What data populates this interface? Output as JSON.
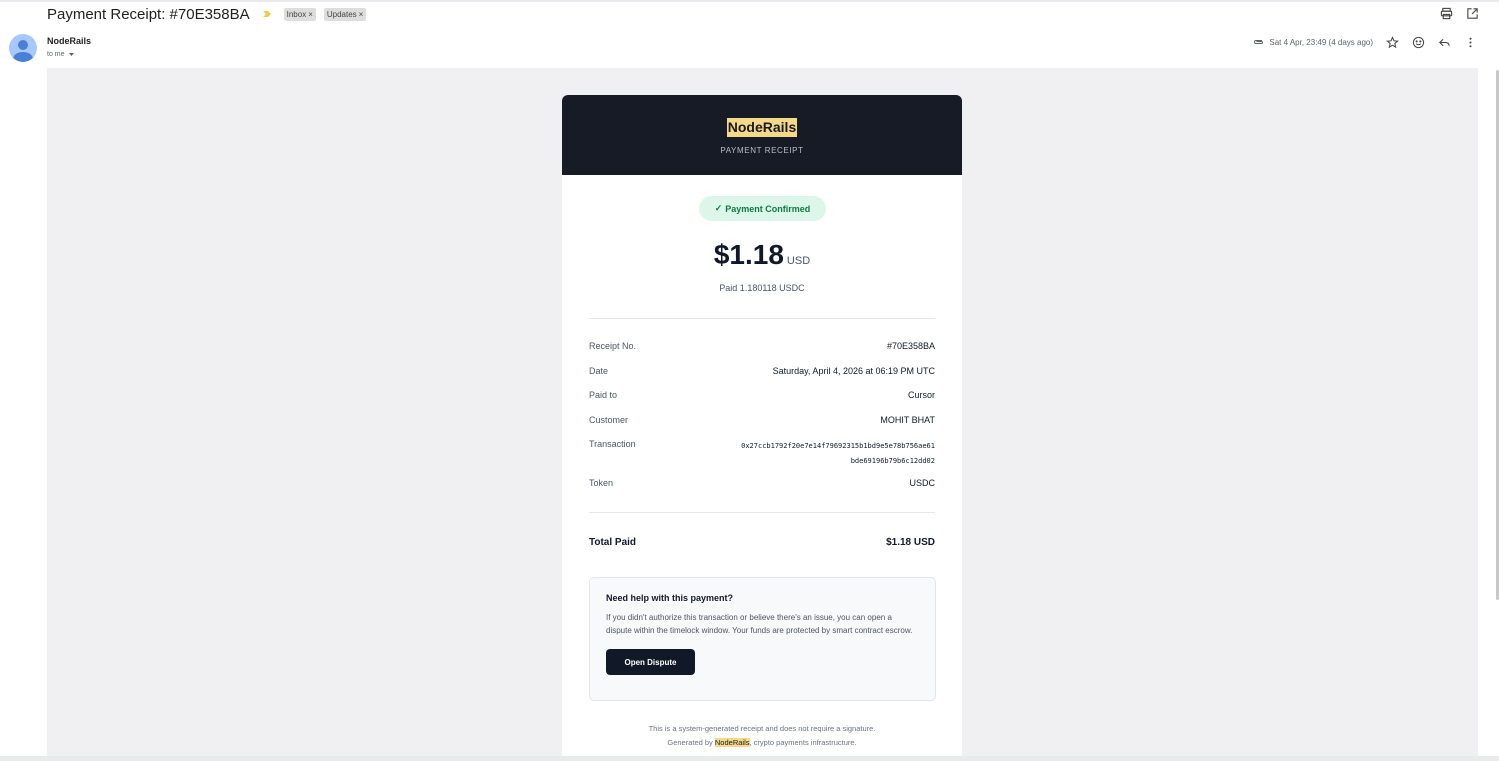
{
  "email": {
    "subject": "Payment Receipt: #70E358BA",
    "labels": [
      {
        "text": "Inbox",
        "remove": "×"
      },
      {
        "text": "Updates",
        "remove": "×"
      }
    ],
    "sender": "NodeRails",
    "to_me": "to me",
    "date": "Sat 4 Apr, 23:49 (4 days ago)"
  },
  "receipt": {
    "brand": "NodeRails",
    "header_subtitle": "PAYMENT RECEIPT",
    "status": "Payment Confirmed",
    "status_check": "✓",
    "amount": "$1.18",
    "currency": "USD",
    "paid_line": "Paid 1.180118 USDC",
    "rows": [
      {
        "key": "Receipt No.",
        "value": "#70E358BA"
      },
      {
        "key": "Date",
        "value": "Saturday, April 4, 2026 at 06:19 PM UTC"
      },
      {
        "key": "Paid to",
        "value": "Cursor"
      },
      {
        "key": "Customer",
        "value": "MOHIT BHAT"
      },
      {
        "key": "Transaction",
        "value_line1": "0x27ccb1792f20e7e14f79692315b1bd9e5e78b756ae61",
        "value_line2": "bde69196b79b6c12dd02"
      },
      {
        "key": "Token",
        "value": "USDC"
      }
    ],
    "total_label": "Total Paid",
    "total_value": "$1.18 USD",
    "help": {
      "title": "Need help with this payment?",
      "body": "If you didn't authorize this transaction or believe there's an issue, you can open a dispute within the timelock window. Your funds are protected by smart contract escrow.",
      "button": "Open Dispute"
    },
    "footer_line1": "This is a system-generated receipt and does not require a signature.",
    "footer_prefix": "Generated by ",
    "footer_brand": "NodeRails",
    "footer_suffix": ", crypto payments infrastructure."
  },
  "colors": {
    "header_bg": "#161b26",
    "brand_highlight": "#f5d98a",
    "confirmed_bg": "#dcf7e9",
    "confirmed_text": "#0b7a43",
    "button_bg": "#111827"
  },
  "icons": [
    "print-icon",
    "open-in-new-icon",
    "attachment-icon",
    "star-icon",
    "emoji-icon",
    "reply-icon",
    "more-vert-icon",
    "importance-icon",
    "chevron-down-icon"
  ]
}
